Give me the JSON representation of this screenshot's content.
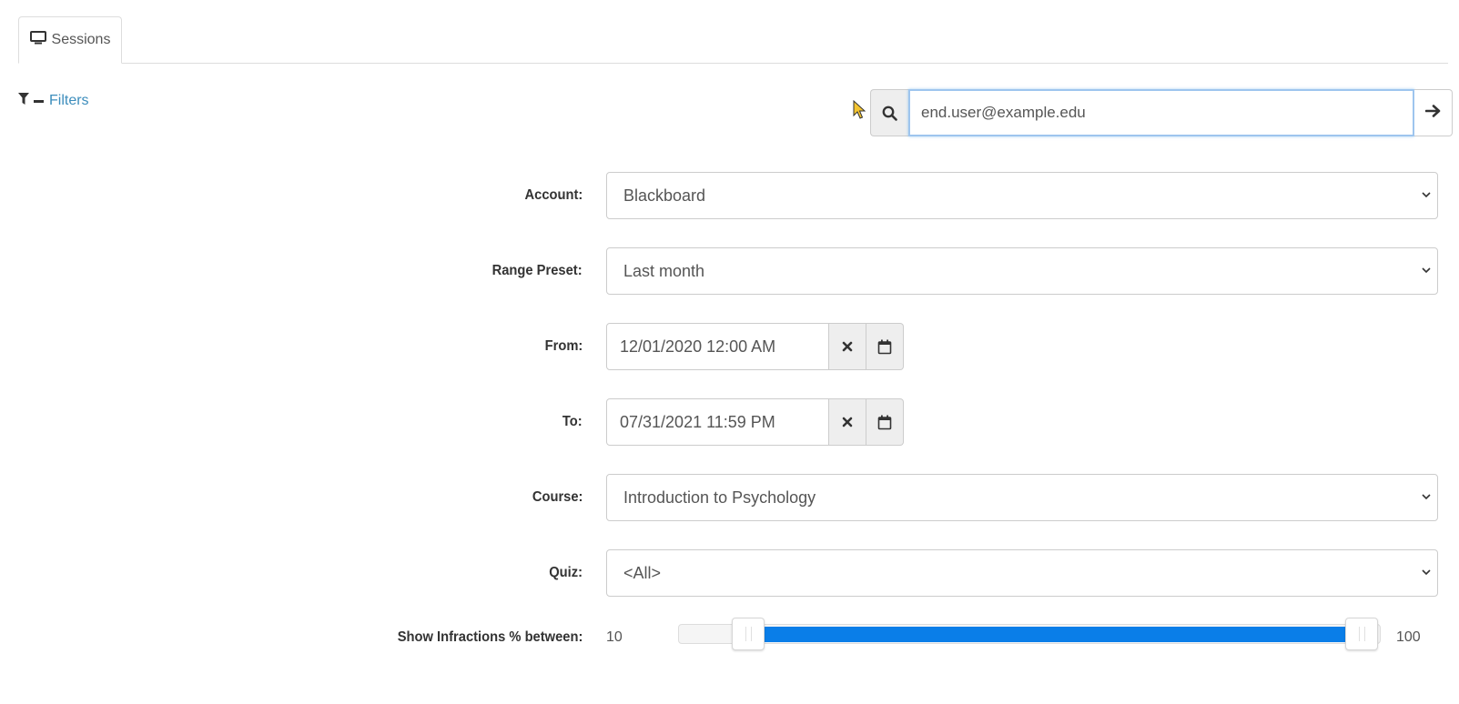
{
  "tabs": [
    {
      "label": "Sessions",
      "icon": "monitor-icon"
    }
  ],
  "filters": {
    "label": "Filters",
    "icon": "filter-icon"
  },
  "search": {
    "value": "end.user@example.edu"
  },
  "form": {
    "account": {
      "label": "Account:",
      "value": "Blackboard"
    },
    "range_preset": {
      "label": "Range Preset:",
      "value": "Last month"
    },
    "from": {
      "label": "From:",
      "value": "12/01/2020 12:00 AM"
    },
    "to": {
      "label": "To:",
      "value": "07/31/2021 11:59 PM"
    },
    "course": {
      "label": "Course:",
      "value": "Introduction to Psychology"
    },
    "quiz": {
      "label": "Quiz:",
      "value": "<All>"
    },
    "infractions": {
      "label": "Show Infractions % between:",
      "min": "10",
      "max": "100",
      "low": 10,
      "high": 100
    }
  },
  "colors": {
    "accent": "#0a7ee8",
    "link": "#3c8dbc"
  }
}
